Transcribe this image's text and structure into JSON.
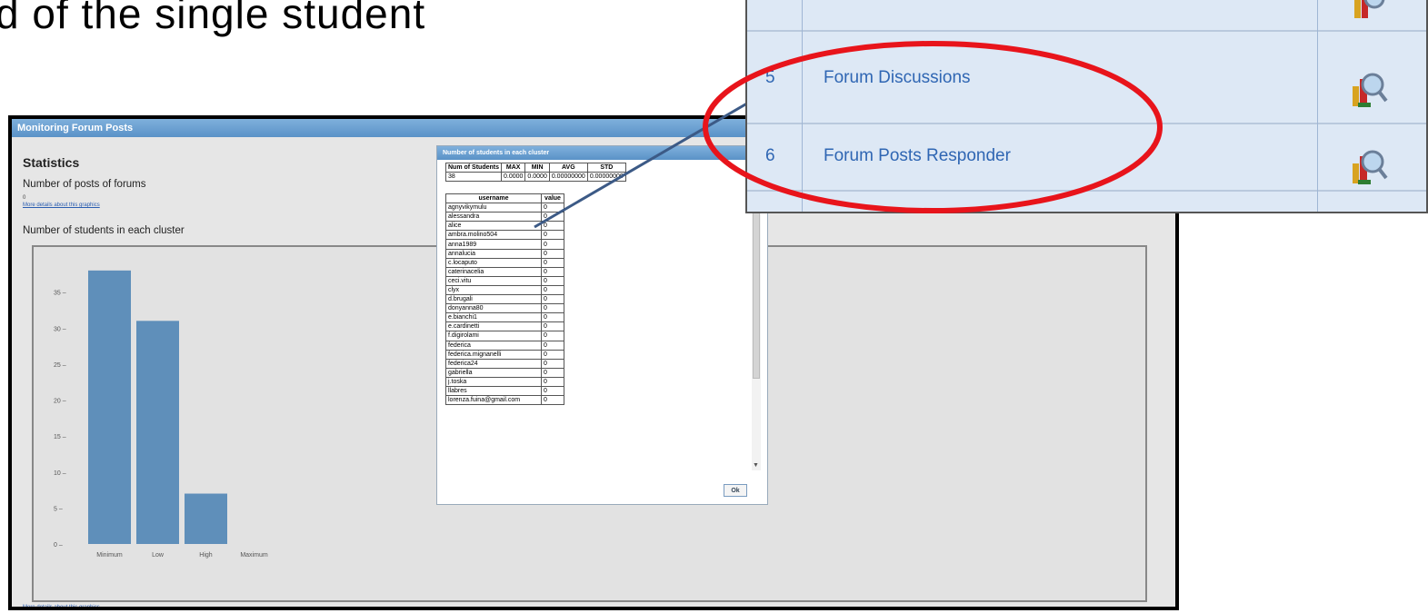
{
  "slide": {
    "heading": "d of the single student"
  },
  "window": {
    "title": "Monitoring Forum Posts"
  },
  "stats": {
    "title": "Statistics",
    "posts_title": "Number of posts of forums",
    "posts_value": "0",
    "details_link": "More details about this graphics",
    "cluster_title": "Number of students in each cluster",
    "details_link_bottom": "More details about this graphics"
  },
  "chart_data": {
    "type": "bar",
    "categories": [
      "Minimum",
      "Low",
      "High",
      "Maximum"
    ],
    "values": [
      38,
      31,
      7,
      0
    ],
    "yticks": [
      "0",
      "5",
      "10",
      "15",
      "20",
      "25",
      "30",
      "35"
    ],
    "ylim": [
      0,
      40
    ],
    "bar_color": "#5f8fba"
  },
  "modal": {
    "title": "Number of students in each cluster",
    "stats_headers": [
      "Num of Students",
      "MAX",
      "MIN",
      "AVG",
      "STD"
    ],
    "stats_values": [
      "38",
      "0.0000",
      "0.0000",
      "0.00000000",
      "0.00000000"
    ],
    "user_headers": [
      "username",
      "value"
    ],
    "users": [
      {
        "username": "agnyvikymulu",
        "value": "0"
      },
      {
        "username": "alessandra",
        "value": "0"
      },
      {
        "username": "alice",
        "value": "0"
      },
      {
        "username": "ambra.molino504",
        "value": "0"
      },
      {
        "username": "anna1989",
        "value": "0"
      },
      {
        "username": "annalucia",
        "value": "0"
      },
      {
        "username": "c.locaputo",
        "value": "0"
      },
      {
        "username": "caterinacelia",
        "value": "0"
      },
      {
        "username": "ceci.vitu",
        "value": "0"
      },
      {
        "username": "clyx",
        "value": "0"
      },
      {
        "username": "d.brugali",
        "value": "0"
      },
      {
        "username": "donyanna80",
        "value": "0"
      },
      {
        "username": "e.bianchi1",
        "value": "0"
      },
      {
        "username": "e.cardinetti",
        "value": "0"
      },
      {
        "username": "f.digirolami",
        "value": "0"
      },
      {
        "username": "federica",
        "value": "0"
      },
      {
        "username": "federica.mignanelli",
        "value": "0"
      },
      {
        "username": "federica24",
        "value": "0"
      },
      {
        "username": "gabriella",
        "value": "0"
      },
      {
        "username": "j.toska",
        "value": "0"
      },
      {
        "username": "llabres",
        "value": "0"
      },
      {
        "username": "lorenza.fuina@gmail.com",
        "value": "0"
      }
    ],
    "ok_label": "Ok"
  },
  "zoom": {
    "rows": [
      {
        "num": "5",
        "label": "Forum Discussions"
      },
      {
        "num": "6",
        "label": "Forum Posts Responder"
      }
    ],
    "highlight_color": "#e8141b",
    "connector_color": "#3c5a86"
  }
}
